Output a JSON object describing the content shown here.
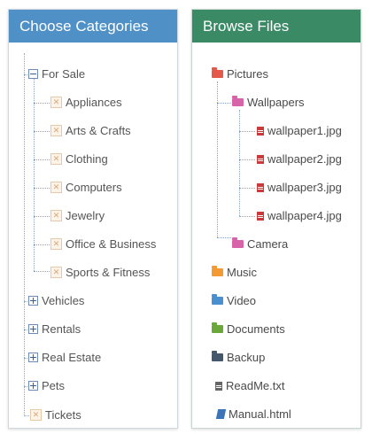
{
  "categories": {
    "title": "Choose Categories",
    "for_sale": {
      "label": "For Sale",
      "children": [
        "Appliances",
        "Arts & Crafts",
        "Clothing",
        "Computers",
        "Jewelry",
        "Office & Business",
        "Sports & Fitness"
      ]
    },
    "collapsed": [
      "Vehicles",
      "Rentals",
      "Real Estate",
      "Pets"
    ],
    "last": "Tickets"
  },
  "files": {
    "title": "Browse Files",
    "pictures": {
      "label": "Pictures",
      "wallpapers": {
        "label": "Wallpapers",
        "files": [
          "wallpaper1.jpg",
          "wallpaper2.jpg",
          "wallpaper3.jpg",
          "wallpaper4.jpg"
        ]
      },
      "camera": "Camera"
    },
    "folders": [
      "Music",
      "Video",
      "Documents",
      "Backup"
    ],
    "readme": "ReadMe.txt",
    "manual": "Manual.html"
  },
  "colors": {
    "categories_header": "#4f90c6",
    "files_header": "#3a8a66",
    "pictures_folder": "#e4594a",
    "wallpapers_folder": "#d764a8",
    "camera_folder": "#d764a8",
    "music_folder": "#f39a33",
    "video_folder": "#4a8fd0",
    "documents_folder": "#6ba83a",
    "backup_folder": "#45576a",
    "jpg_file": "#c83b3b",
    "txt_file": "#666666"
  }
}
